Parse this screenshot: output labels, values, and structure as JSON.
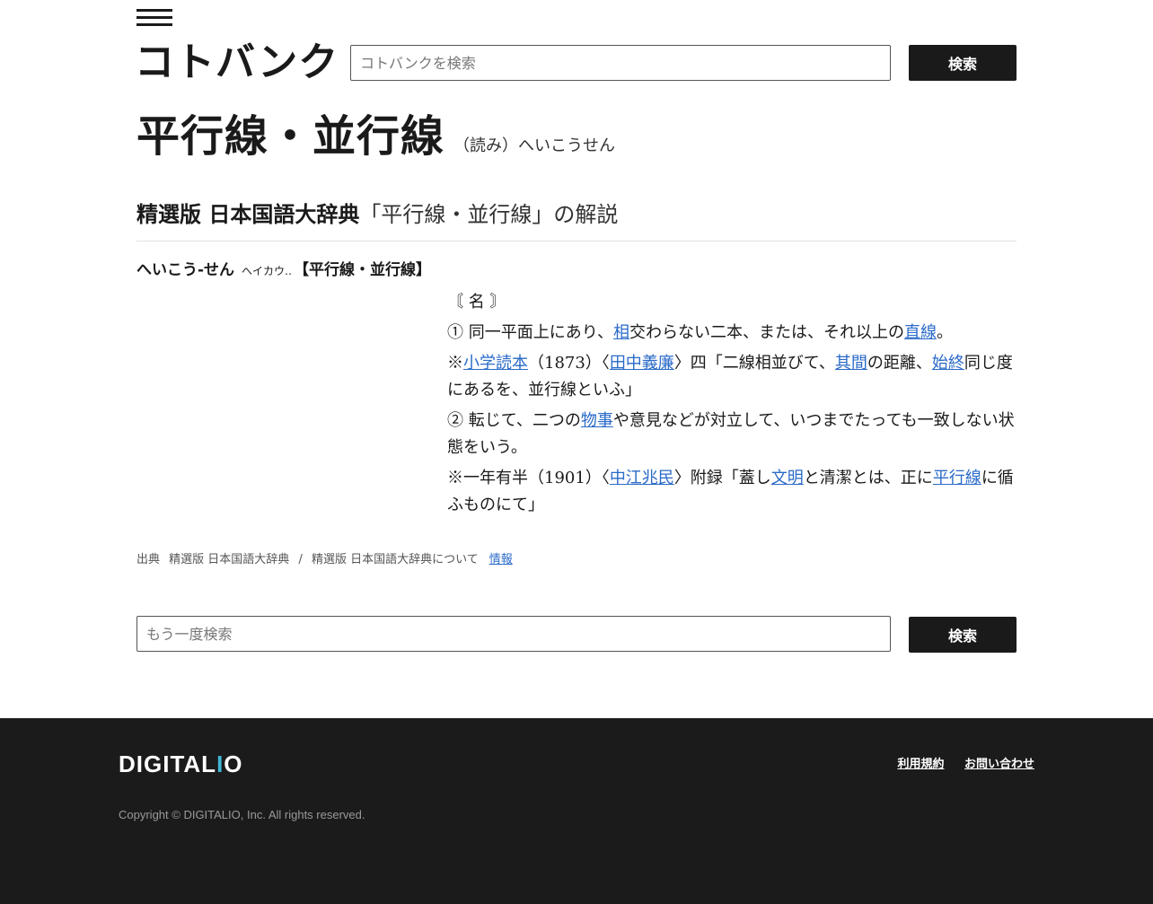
{
  "header": {
    "logo": "コトバンク",
    "search_placeholder": "コトバンクを検索",
    "search_button": "検索"
  },
  "entry": {
    "title": "平行線・並行線",
    "reading": "（読み）へいこうせん"
  },
  "section": {
    "dictionary": "精選版 日本国語大辞典",
    "description": "「平行線・並行線」の解説"
  },
  "headword": {
    "kana": "へいこう-せん",
    "old_kana": "へイカウ‥",
    "kanji": "【平行線・並行線】"
  },
  "definition": {
    "pos": "〘 名 〙",
    "sense1": {
      "t1": "① 同一平面上にあり、",
      "l1": "相",
      "t2": "交わらない二本、または、それ以上の",
      "l2": "直線",
      "t3": "。"
    },
    "example1": {
      "t1": "※",
      "l1": "小学読本",
      "t2": "（1873）〈",
      "l2": "田中義廉",
      "t3": "〉四「二線相並びて、",
      "l3": "其間",
      "t4": "の距離、",
      "l4": "始終",
      "t5": "同じ度にあるを、並行線といふ」"
    },
    "sense2": {
      "t1": "② 転じて、二つの",
      "l1": "物事",
      "t2": "や意見などが対立して、いつまでたっても一致しない状態をいう。"
    },
    "example2": {
      "t1": "※一年有半（1901）〈",
      "l1": "中江兆民",
      "t2": "〉附録「蓋し",
      "l2": "文明",
      "t3": "と清潔とは、正に",
      "l3": "平行線",
      "t4": "に循ふものにて」"
    }
  },
  "source": {
    "label": "出典",
    "name": "精選版 日本国語大辞典",
    "separator": "/",
    "about": "精選版 日本国語大辞典について",
    "info_link": "情報"
  },
  "bottom_search": {
    "placeholder": "もう一度検索",
    "button": "検索"
  },
  "footer": {
    "logo_left": "DIGITAL",
    "logo_dot": "I",
    "logo_right": "O",
    "terms": "利用規約",
    "contact": "お問い合わせ",
    "copyright": "Copyright © DIGITALIO, Inc. All rights reserved."
  }
}
